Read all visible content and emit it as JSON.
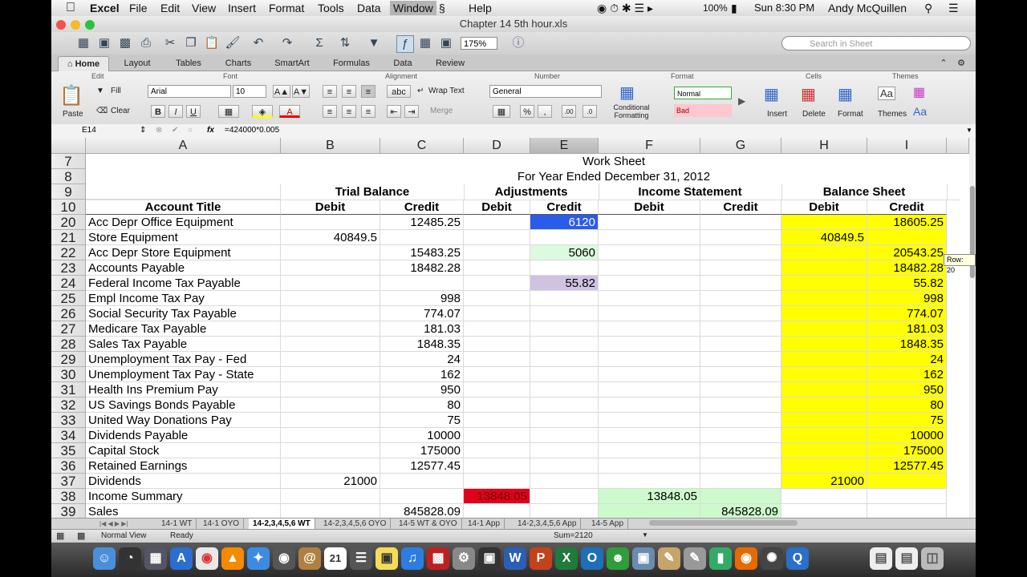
{
  "menubar": {
    "app": "Excel",
    "items": [
      "File",
      "Edit",
      "View",
      "Insert",
      "Format",
      "Tools",
      "Data",
      "Window",
      "Help"
    ],
    "battery": "100%",
    "clock": "Sun 8:30 PM",
    "user": "Andy McQuillen"
  },
  "window": {
    "title": "Chapter 14 5th hour.xls"
  },
  "toolbar": {
    "zoom": "175%",
    "search_placeholder": "Search in Sheet"
  },
  "ribbon_tabs": [
    "Home",
    "Layout",
    "Tables",
    "Charts",
    "SmartArt",
    "Formulas",
    "Data",
    "Review"
  ],
  "ribbon": {
    "groups": [
      "Edit",
      "Font",
      "Alignment",
      "Number",
      "Format",
      "Cells",
      "Themes"
    ],
    "fill": "Fill",
    "clear": "Clear",
    "paste": "Paste",
    "font_name": "Arial",
    "font_size": "10",
    "wrap_text": "Wrap Text",
    "merge": "Merge",
    "number_format": "General",
    "conditional_formatting": "Conditional Formatting",
    "style_normal": "Normal",
    "style_bad": "Bad",
    "insert": "Insert",
    "delete": "Delete",
    "format": "Format",
    "themes": "Themes",
    "bold": "B",
    "italic": "I",
    "underline": "U",
    "percent": "%",
    "aa": "Aa"
  },
  "formula_bar": {
    "cell_ref": "E14",
    "fx": "fx",
    "formula": "=424000*0.005"
  },
  "grid": {
    "columns": [
      "A",
      "B",
      "C",
      "D",
      "E",
      "F",
      "G",
      "H",
      "I"
    ],
    "title1": "Work Sheet",
    "title2": "For Year Ended December 31, 2012",
    "headers": {
      "trial": "Trial Balance",
      "adj": "Adjustments",
      "inc": "Income Statement",
      "bal": "Balance Sheet"
    },
    "row10": {
      "a": "Account Title",
      "debit": "Debit",
      "credit": "Credit"
    },
    "header_row_numbers": [
      "7",
      "8",
      "9",
      "10"
    ],
    "rows": [
      {
        "n": "20",
        "a": "Acc Depr Office Equipment",
        "c": "12485.25",
        "e": "6120",
        "i": "18605.25"
      },
      {
        "n": "21",
        "a": "Store Equipment",
        "b": "40849.5",
        "h": "40849.5"
      },
      {
        "n": "22",
        "a": "Acc Depr Store Equipment",
        "c": "15483.25",
        "e": "5060",
        "i": "20543.25"
      },
      {
        "n": "23",
        "a": "Accounts Payable",
        "c": "18482.28",
        "i": "18482.28"
      },
      {
        "n": "24",
        "a": "Federal Income Tax Payable",
        "e": "55.82",
        "i": "55.82"
      },
      {
        "n": "25",
        "a": "Empl Income Tax Pay",
        "c": "998",
        "i": "998"
      },
      {
        "n": "26",
        "a": "Social Security Tax Payable",
        "c": "774.07",
        "i": "774.07"
      },
      {
        "n": "27",
        "a": "Medicare Tax Payable",
        "c": "181.03",
        "i": "181.03"
      },
      {
        "n": "28",
        "a": "Sales Tax Payable",
        "c": "1848.35",
        "i": "1848.35"
      },
      {
        "n": "29",
        "a": "Unemployment Tax Pay - Fed",
        "c": "24",
        "i": "24"
      },
      {
        "n": "30",
        "a": "Unemployment Tax Pay - State",
        "c": "162",
        "i": "162"
      },
      {
        "n": "31",
        "a": "Health Ins Premium Pay",
        "c": "950",
        "i": "950"
      },
      {
        "n": "32",
        "a": "US Savings Bonds Payable",
        "c": "80",
        "i": "80"
      },
      {
        "n": "33",
        "a": "United Way Donations Pay",
        "c": "75",
        "i": "75"
      },
      {
        "n": "34",
        "a": "Dividends Payable",
        "c": "10000",
        "i": "10000"
      },
      {
        "n": "35",
        "a": "Capital Stock",
        "c": "175000",
        "i": "175000"
      },
      {
        "n": "36",
        "a": "Retained Earnings",
        "c": "12577.45",
        "i": "12577.45"
      },
      {
        "n": "37",
        "a": "Dividends",
        "b": "21000",
        "h": "21000"
      },
      {
        "n": "38",
        "a": "Income Summary",
        "d": "13848.05",
        "f": "13848.05"
      },
      {
        "n": "39",
        "a": "Sales",
        "c": "845828.09",
        "g": "845828.09"
      }
    ],
    "tooltip": "Row: 20"
  },
  "sheet_tabs": [
    "14-1 WT",
    "14-1 OYO",
    "14-2,3,4,5,6 WT",
    "14-2,3,4,5,6 OYO",
    "14-5 WT & OYO",
    "14-1 App",
    "14-2,3,4,5,6 App",
    "14-5 App"
  ],
  "status": {
    "view": "Normal View",
    "ready": "Ready",
    "sum": "Sum=2120"
  },
  "colors": {
    "yellow": "#ffff00",
    "blue": "#2b5bea",
    "green": "#dcfadd",
    "lavender": "#cfc3e0",
    "red": "#e0001c"
  },
  "dock_icons": [
    "finder-icon",
    "dashboard-icon",
    "mission-control-icon",
    "chrome-icon",
    "vlc-icon",
    "safari-icon",
    "facetime-icon",
    "contacts-icon",
    "calendar-icon",
    "stickies-icon",
    "itunes-icon",
    "photo-booth-icon",
    "system-preferences-icon",
    "word-icon",
    "powerpoint-icon",
    "excel-icon",
    "outlook-icon",
    "messenger-icon",
    "preview-icon",
    "textedit-icon",
    "firefox-icon",
    "spinner-icon",
    "quicktime-icon",
    "document-icon",
    "trash-icon"
  ]
}
